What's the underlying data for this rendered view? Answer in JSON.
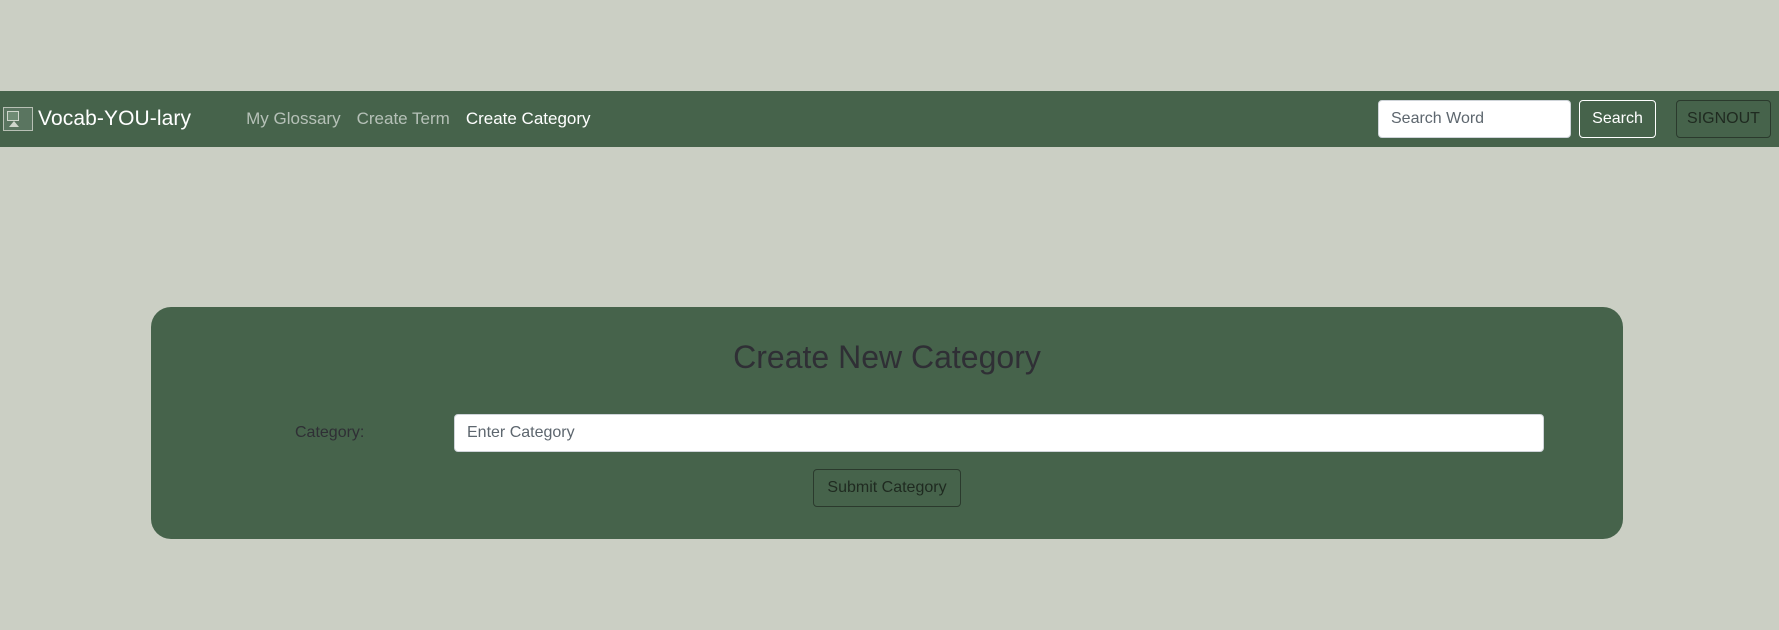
{
  "navbar": {
    "brand": {
      "logo_icon": "broken-image-icon",
      "title": "Vocab-YOU-lary"
    },
    "links": [
      {
        "label": "My Glossary",
        "active": false
      },
      {
        "label": "Create Term",
        "active": false
      },
      {
        "label": "Create Category",
        "active": true
      }
    ],
    "search": {
      "placeholder": "Search Word",
      "value": "",
      "button_label": "Search"
    },
    "signout_label": "SIGNOUT"
  },
  "form": {
    "title": "Create New Category",
    "category_label": "Category:",
    "category_placeholder": "Enter Category",
    "category_value": "",
    "submit_label": "Submit Category"
  },
  "colors": {
    "page_background": "#cbcfc4",
    "navbar_background": "#46634b",
    "card_background": "#46634b",
    "heading_text": "#2f2f35"
  }
}
